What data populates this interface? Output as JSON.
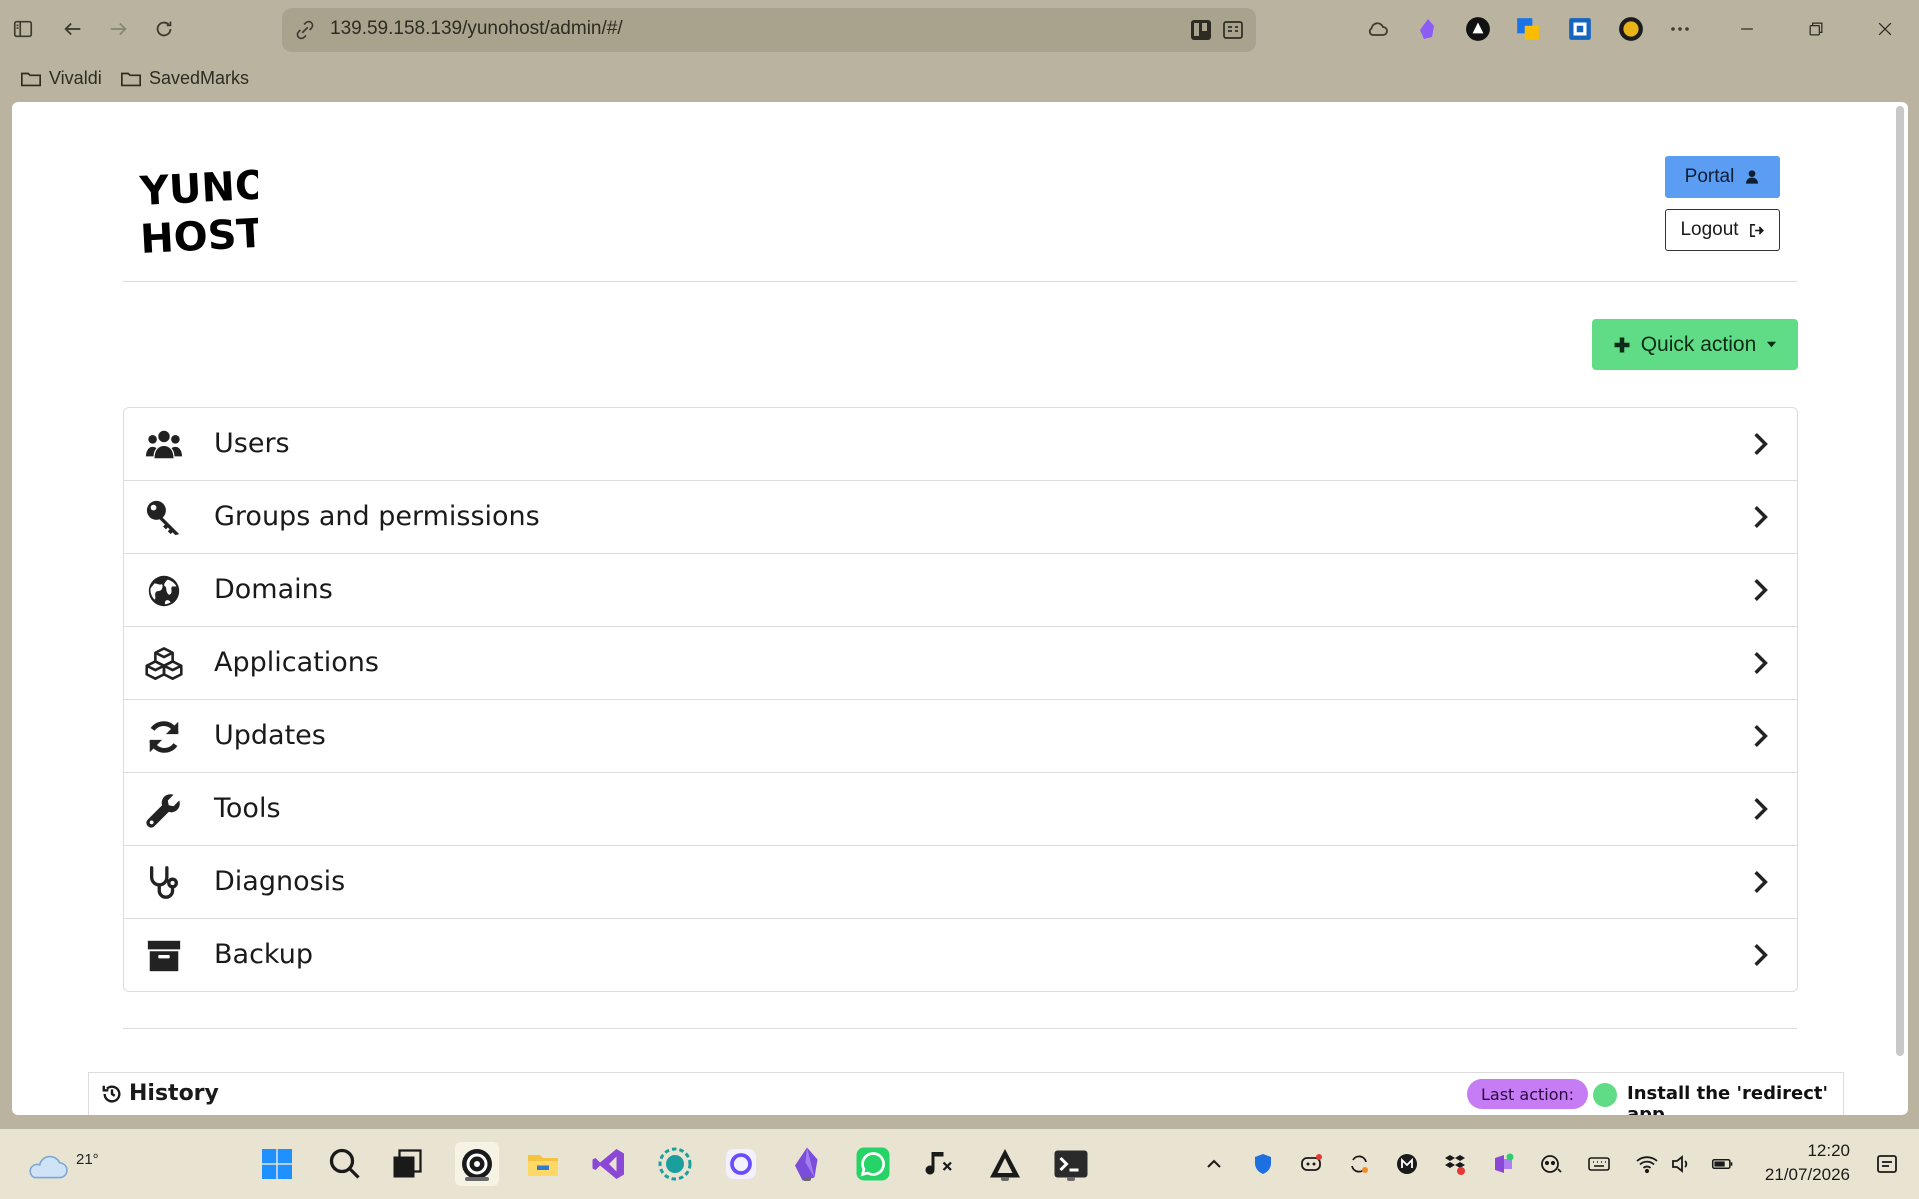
{
  "browser": {
    "url": "139.59.158.139/yunohost/admin/#/",
    "bookmarks": [
      "Vivaldi",
      "SavedMarks"
    ]
  },
  "header": {
    "logo_lines": [
      "YUNO",
      "HOST"
    ],
    "portal_label": "Portal",
    "logout_label": "Logout"
  },
  "quick_action": {
    "label": "Quick action"
  },
  "menu": {
    "items": [
      {
        "label": "Users",
        "icon": "users-icon"
      },
      {
        "label": "Groups and permissions",
        "icon": "key-icon"
      },
      {
        "label": "Domains",
        "icon": "globe-icon"
      },
      {
        "label": "Applications",
        "icon": "cubes-icon"
      },
      {
        "label": "Updates",
        "icon": "refresh-icon"
      },
      {
        "label": "Tools",
        "icon": "wrench-icon"
      },
      {
        "label": "Diagnosis",
        "icon": "stethoscope-icon"
      },
      {
        "label": "Backup",
        "icon": "archive-icon"
      }
    ]
  },
  "history": {
    "label": "History",
    "last_action_badge": "Last action:",
    "last_action_text": "Install the 'redirect' app"
  },
  "taskbar": {
    "weather_temp": "21°",
    "time": "12:20",
    "date": "21/07/2026"
  },
  "colors": {
    "portal_button": "#5b9df2",
    "quick_action": "#5fdc85",
    "last_action_badge": "#c67cf5",
    "chrome": "#b9b39f"
  }
}
